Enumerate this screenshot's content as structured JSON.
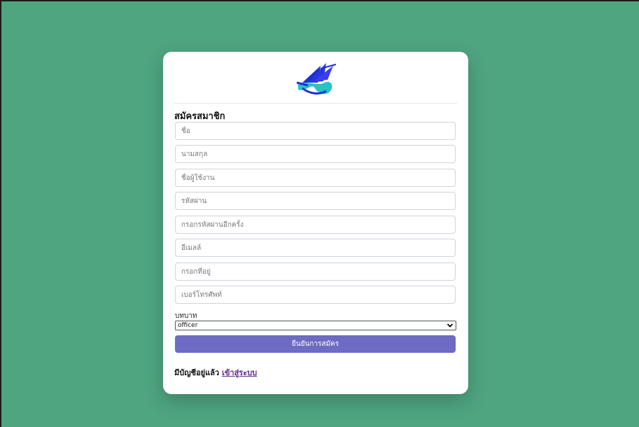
{
  "form": {
    "title": "สมัครสมาชิก",
    "fields": [
      {
        "name": "first-name-input",
        "placeholder": "ชื่อ"
      },
      {
        "name": "last-name-input",
        "placeholder": "นามสกุล"
      },
      {
        "name": "username-input",
        "placeholder": "ชื่อผู้ใช้งาน"
      },
      {
        "name": "password-input",
        "placeholder": "รหัสผ่าน"
      },
      {
        "name": "confirm-password-input",
        "placeholder": "กรอกรหัสผ่านอีกครั้ง"
      },
      {
        "name": "email-input",
        "placeholder": "อีเมลล์"
      },
      {
        "name": "address-input",
        "placeholder": "กรอกที่อยู่"
      },
      {
        "name": "phone-input",
        "placeholder": "เบอร์โทรศัพท์"
      }
    ],
    "role_label": "บทบาท",
    "role_value": "officer",
    "submit_label": "ยืนยันการสมัคร"
  },
  "footer": {
    "text": "มีบัญชีอยู่แล้ว",
    "login_link": "เข้าสู่ระบบ"
  },
  "colors": {
    "background": "#4fa580",
    "button": "#6d6bc3",
    "logo_primary": "#1f2fd6",
    "logo_secondary": "#27c3c7"
  },
  "icons": {
    "logo": "ship-logo-icon",
    "select_arrow": "chevron-down-icon"
  }
}
